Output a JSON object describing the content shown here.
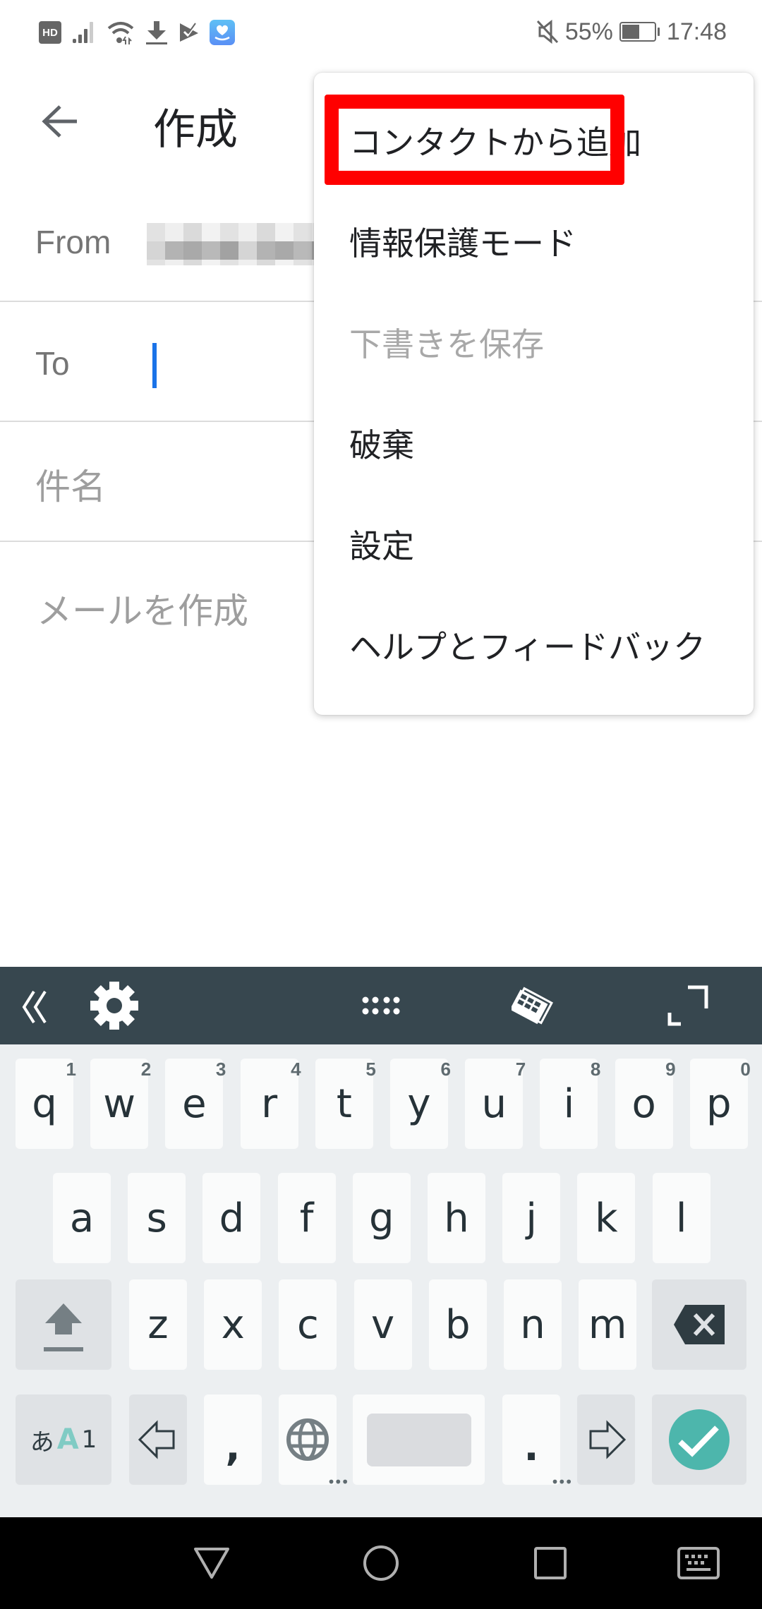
{
  "status_bar": {
    "left_icons": [
      "hd-icon",
      "signal-icon",
      "wifi-icon",
      "download-icon",
      "task-check-icon",
      "health-app-icon"
    ],
    "hd_label": "HD",
    "mute_icon": "mute-icon",
    "battery_percent": "55%",
    "battery_level": 0.55,
    "time": "17:48"
  },
  "app_bar": {
    "back_icon": "arrow-back-icon",
    "title": "作成"
  },
  "compose": {
    "from_label": "From",
    "from_value_redacted": true,
    "to_label": "To",
    "to_value": "",
    "subject_placeholder": "件名",
    "body_placeholder": "メールを作成"
  },
  "overflow_menu": {
    "items": [
      {
        "label": "コンタクトから追加",
        "enabled": true,
        "highlighted": true
      },
      {
        "label": "情報保護モード",
        "enabled": true
      },
      {
        "label": "下書きを保存",
        "enabled": false
      },
      {
        "label": "破棄",
        "enabled": true
      },
      {
        "label": "設定",
        "enabled": true
      },
      {
        "label": "ヘルプとフィードバック",
        "enabled": true
      }
    ],
    "highlight_color": "#ff0000"
  },
  "keyboard": {
    "toolbar": [
      "collapse-icon",
      "settings-gear-icon",
      "dots-grid-icon",
      "keyboard-tilt-icon",
      "expand-icon"
    ],
    "row1": [
      {
        "key": "q",
        "hint": "1"
      },
      {
        "key": "w",
        "hint": "2"
      },
      {
        "key": "e",
        "hint": "3"
      },
      {
        "key": "r",
        "hint": "4"
      },
      {
        "key": "t",
        "hint": "5"
      },
      {
        "key": "y",
        "hint": "6"
      },
      {
        "key": "u",
        "hint": "7"
      },
      {
        "key": "i",
        "hint": "8"
      },
      {
        "key": "o",
        "hint": "9"
      },
      {
        "key": "p",
        "hint": "0"
      }
    ],
    "row2": [
      "a",
      "s",
      "d",
      "f",
      "g",
      "h",
      "j",
      "k",
      "l"
    ],
    "row3": [
      "z",
      "x",
      "c",
      "v",
      "b",
      "n",
      "m"
    ],
    "mode_key": {
      "hira": "あ",
      "alpha": "A",
      "num": "1"
    },
    "comma": ",",
    "period": ".",
    "accent_color": "#4db6ac"
  },
  "nav_bar": {
    "buttons": [
      "back-triangle-icon",
      "home-circle-icon",
      "recents-square-icon",
      "keyboard-switch-icon"
    ]
  }
}
